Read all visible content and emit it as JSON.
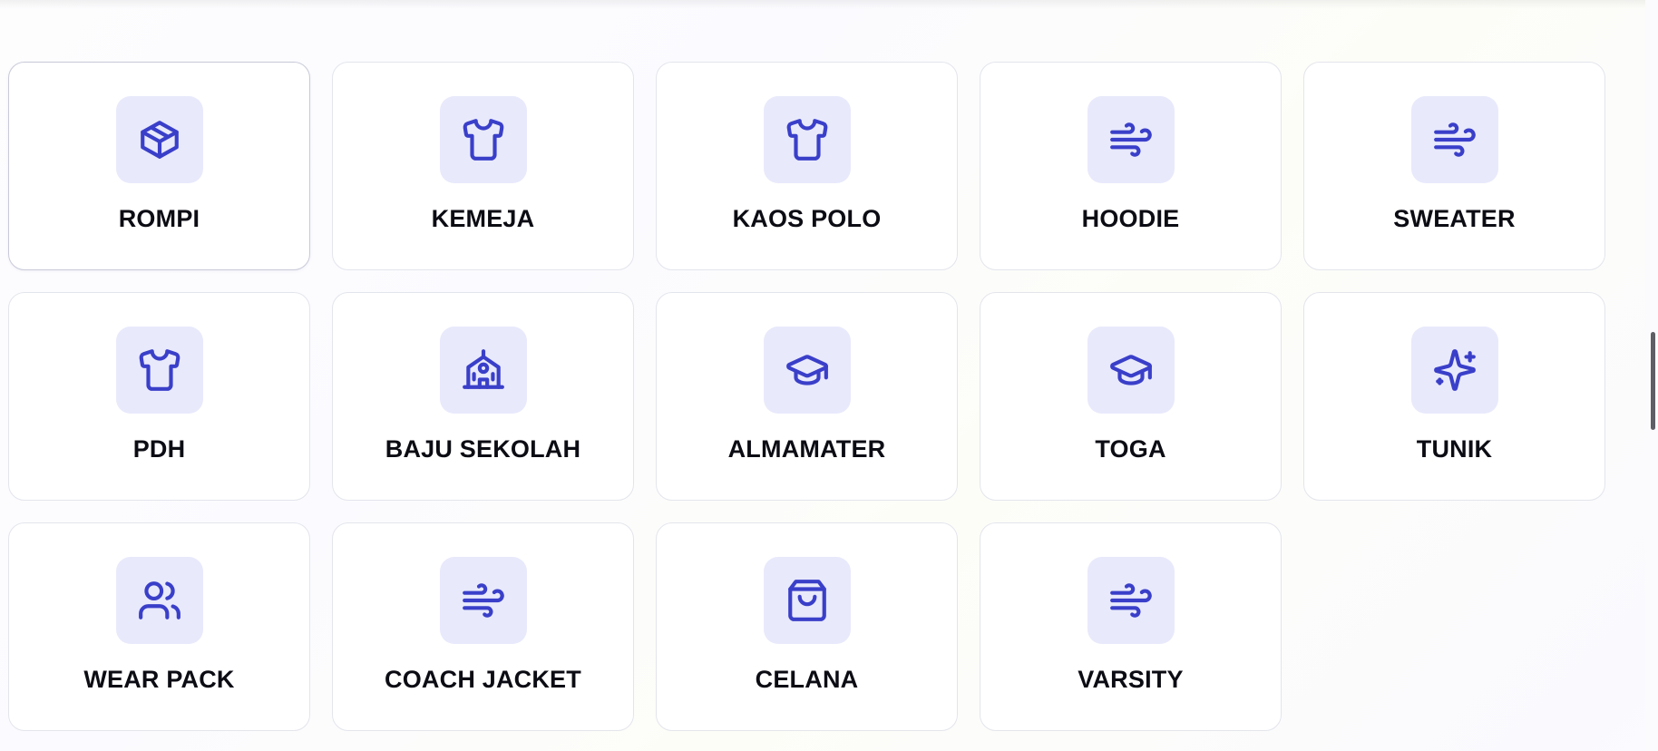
{
  "categories": [
    {
      "label": "ROMPI",
      "icon": "package-icon"
    },
    {
      "label": "KEMEJA",
      "icon": "shirt-icon"
    },
    {
      "label": "KAOS POLO",
      "icon": "shirt-icon"
    },
    {
      "label": "HOODIE",
      "icon": "wind-icon"
    },
    {
      "label": "SWEATER",
      "icon": "wind-icon"
    },
    {
      "label": "PDH",
      "icon": "shirt-icon"
    },
    {
      "label": "BAJU SEKOLAH",
      "icon": "school-icon"
    },
    {
      "label": "ALMAMATER",
      "icon": "graduation-cap-icon"
    },
    {
      "label": "TOGA",
      "icon": "graduation-cap-icon"
    },
    {
      "label": "TUNIK",
      "icon": "sparkles-icon"
    },
    {
      "label": "WEAR PACK",
      "icon": "users-icon"
    },
    {
      "label": "COACH JACKET",
      "icon": "wind-icon"
    },
    {
      "label": "CELANA",
      "icon": "shopping-bag-icon"
    },
    {
      "label": "VARSITY",
      "icon": "wind-icon"
    }
  ],
  "colors": {
    "accent": "#3a3fc9",
    "icon_tile_bg": "#e8e9fb",
    "card_border": "#e3e5ec",
    "label_text": "#0c0c14"
  }
}
